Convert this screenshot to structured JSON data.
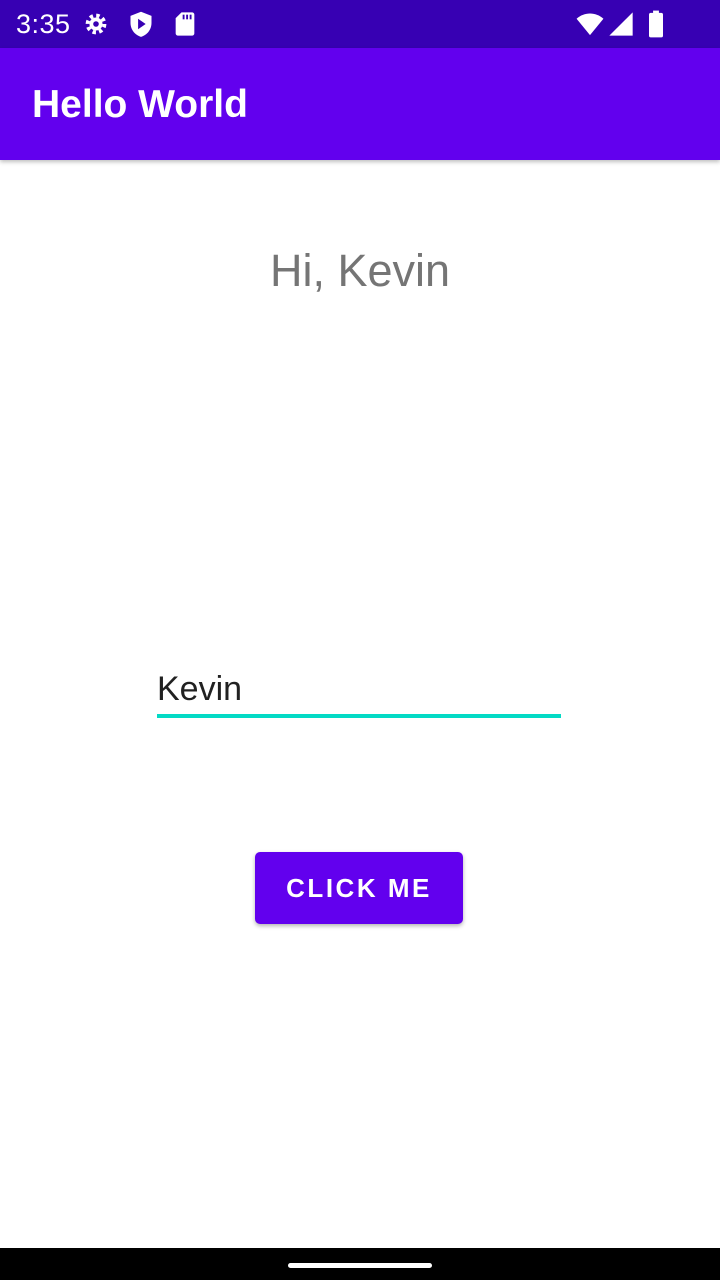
{
  "status_bar": {
    "time": "3:35",
    "icons": [
      "settings-icon",
      "shield-icon",
      "sd-card-icon",
      "wifi-icon",
      "signal-icon",
      "battery-icon"
    ]
  },
  "app_bar": {
    "title": "Hello World"
  },
  "main": {
    "greeting": "Hi, Kevin",
    "name_input": {
      "value": "Kevin"
    },
    "button_label": "Click me"
  },
  "colors": {
    "status_bar": "#3700b3",
    "primary": "#6200ee",
    "accent": "#03dac5",
    "greeting_text": "#757575"
  }
}
